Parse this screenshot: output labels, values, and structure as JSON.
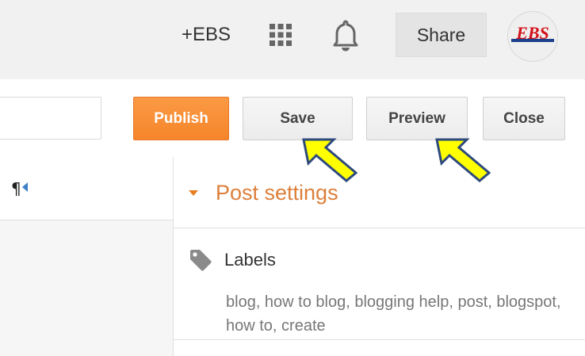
{
  "gbar": {
    "user_label": "+EBS",
    "apps_icon": "apps-grid-icon",
    "notifications_icon": "bell-icon",
    "share_label": "Share",
    "avatar_text": "EBS"
  },
  "toolbar": {
    "title_value": "",
    "publish_label": "Publish",
    "save_label": "Save",
    "preview_label": "Preview",
    "close_label": "Close",
    "publish_color": "#f68b2f"
  },
  "editor": {
    "paragraph_icon": "¶"
  },
  "post_settings": {
    "title": "Post settings",
    "accent_color": "#dd7f3a",
    "labels": {
      "title": "Labels",
      "icon": "tag-icon",
      "values": "blog, how to blog, blogging help, post, blogspot, how to, create"
    }
  },
  "annotations": {
    "arrow_color": "#ffff00",
    "arrow_outline": "#2e4a7d"
  }
}
